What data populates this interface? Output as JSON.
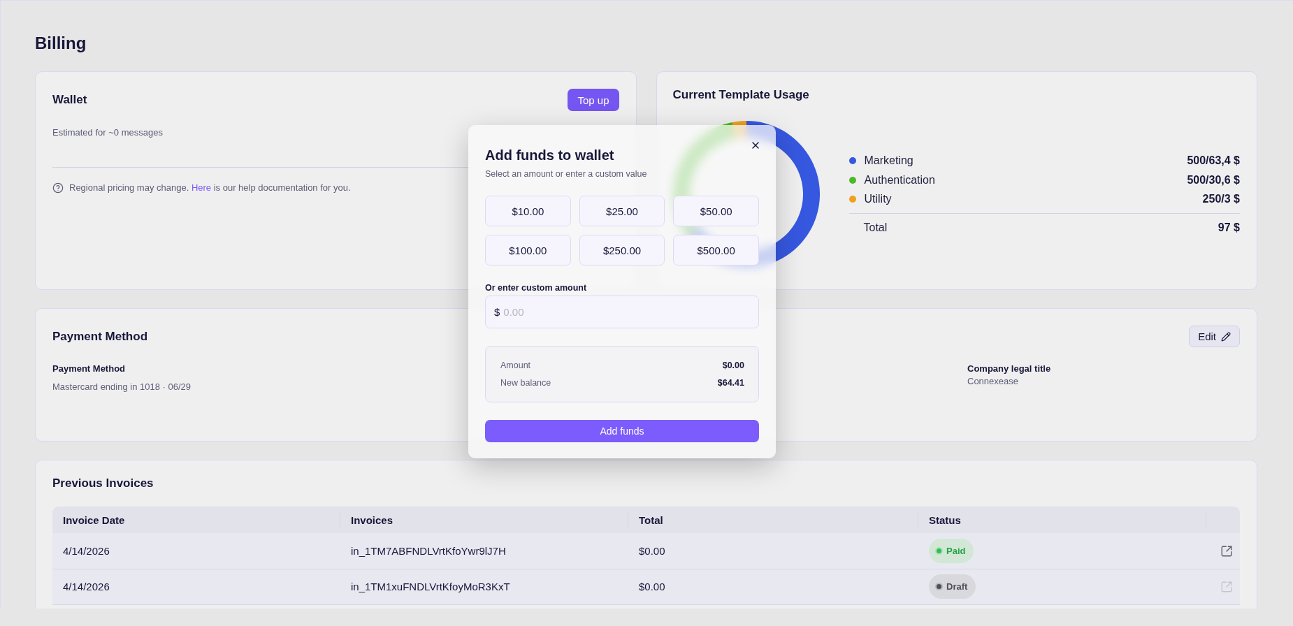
{
  "page": {
    "title": "Billing"
  },
  "wallet": {
    "title": "Wallet",
    "top_up_button": "Top up",
    "estimate": "Estimated for ~0 messages",
    "notice": {
      "before": "Regional pricing may change.",
      "link": "Here",
      "after": "is our help documentation for you."
    }
  },
  "template_usage": {
    "title": "Current Template Usage",
    "legend": [
      {
        "label": "Marketing",
        "value": "500/63,4 $",
        "color": "#3658e0"
      },
      {
        "label": "Authentication",
        "value": "500/30,6 $",
        "color": "#4cba28"
      },
      {
        "label": "Utility",
        "value": "250/3 $",
        "color": "#f0a01e"
      }
    ],
    "total": {
      "label": "Total",
      "value": "97 $"
    }
  },
  "payment": {
    "title": "Payment Method",
    "edit_button": "Edit",
    "fields": [
      {
        "label": "Payment Method",
        "value": "Mastercard ending in 1018 · 06/29"
      },
      {
        "label": "Company legal title",
        "value": "Connexease"
      }
    ]
  },
  "invoices": {
    "title": "Previous Invoices",
    "columns": [
      "Invoice Date",
      "Invoices",
      "Total",
      "Status"
    ],
    "rows": [
      {
        "date": "4/14/2026",
        "invoice": "in_1TM7ABFNDLVrtKfoYwr9lJ7H",
        "total": "$0.00",
        "status": {
          "label": "Paid",
          "kind": "paid"
        },
        "link_disabled": false
      },
      {
        "date": "4/14/2026",
        "invoice": "in_1TM1xuFNDLVrtKfoyMoR3KxT",
        "total": "$0.00",
        "status": {
          "label": "Draft",
          "kind": "draft"
        },
        "link_disabled": true
      }
    ]
  },
  "modal": {
    "title": "Add funds to wallet",
    "subtitle": "Select an amount or enter a custom value",
    "amounts": [
      {
        "label": "$10.00",
        "selected": false
      },
      {
        "label": "$25.00",
        "selected": false
      },
      {
        "label": "$50.00",
        "selected": false
      },
      {
        "label": "$100.00",
        "selected": false
      },
      {
        "label": "$250.00",
        "selected": false
      },
      {
        "label": "$500.00",
        "selected": false
      }
    ],
    "custom_label": "Or enter custom amount",
    "currency": "$",
    "placeholder": "0.00",
    "summary": [
      {
        "label": "Amount",
        "value": "$0.00"
      },
      {
        "label": "New balance",
        "value": "$64.41"
      }
    ],
    "submit_button": "Add funds"
  }
}
